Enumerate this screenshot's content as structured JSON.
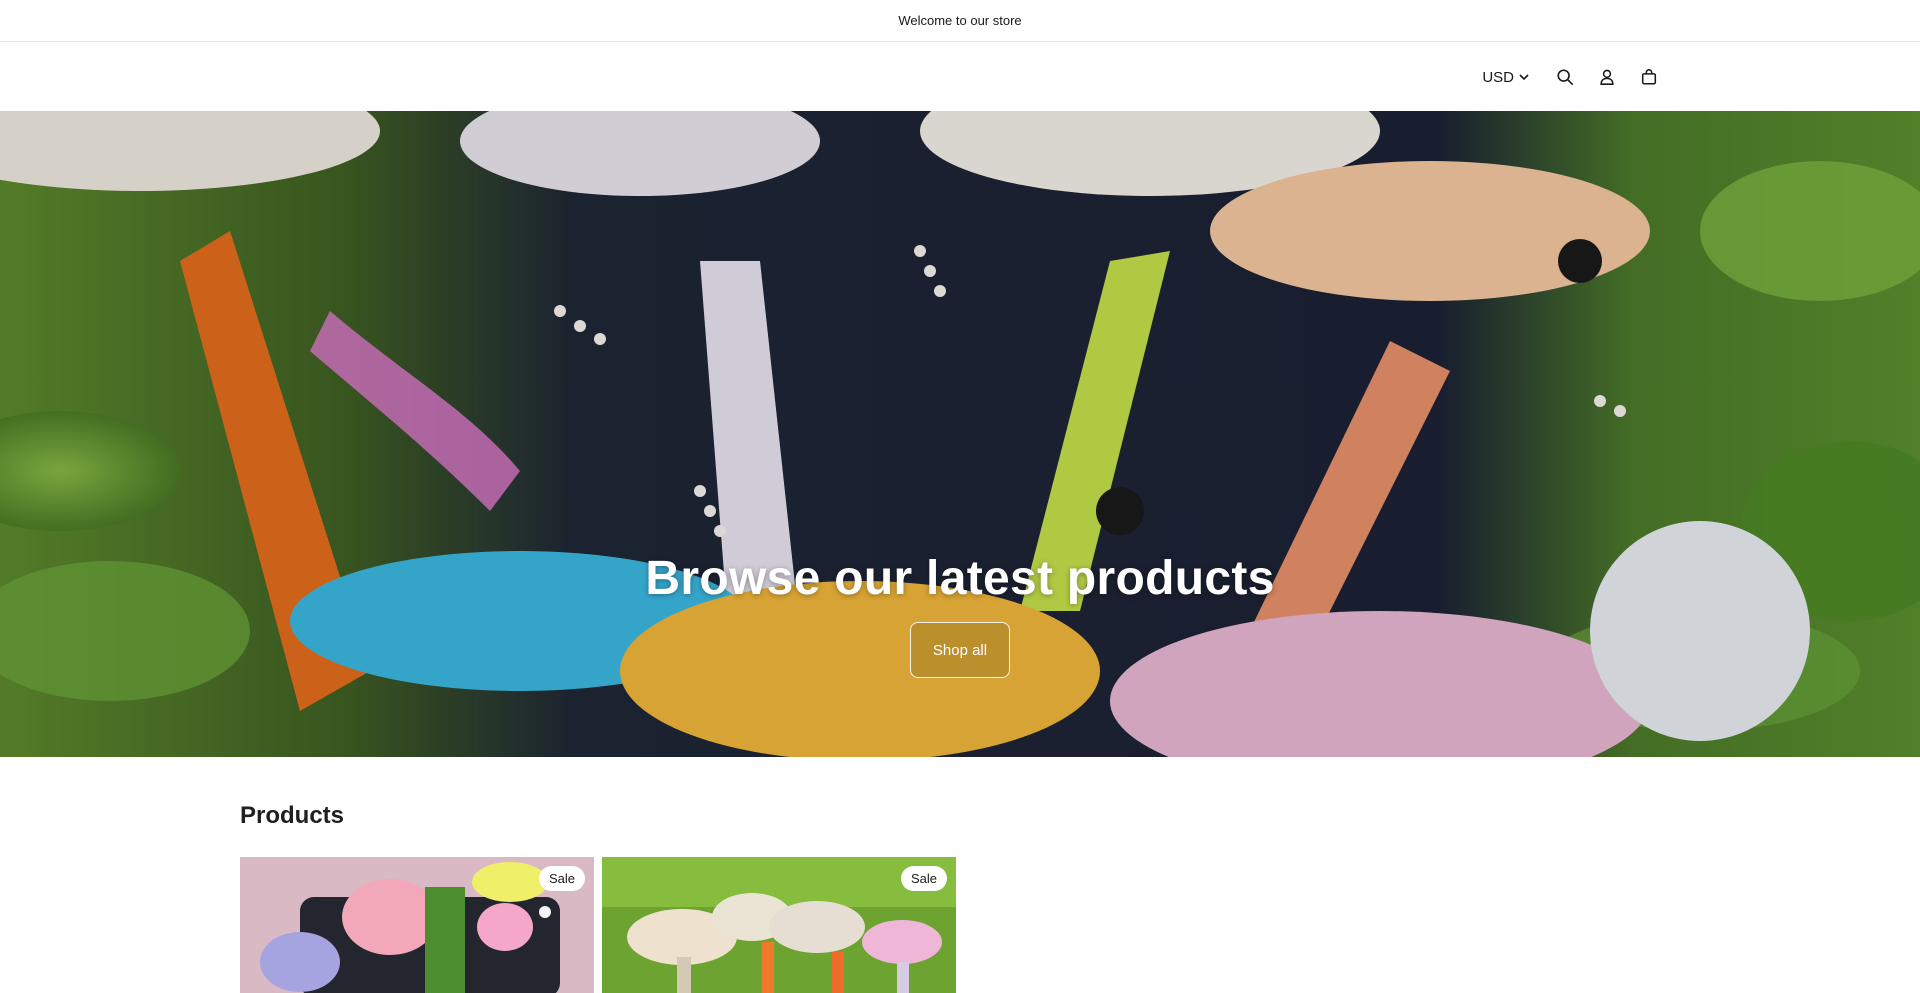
{
  "announcement": {
    "text": "Welcome to our store"
  },
  "header": {
    "currency": "USD",
    "icons": [
      "search-icon",
      "account-icon",
      "cart-icon"
    ]
  },
  "hero": {
    "title": "Browse our latest products",
    "button_label": "Shop all"
  },
  "products": {
    "heading": "Products",
    "items": [
      {
        "badge": "Sale"
      },
      {
        "badge": "Sale"
      }
    ]
  },
  "colors": {
    "text": "#121212",
    "border": "#e6e6e6",
    "badge_bg": "#ffffff"
  }
}
